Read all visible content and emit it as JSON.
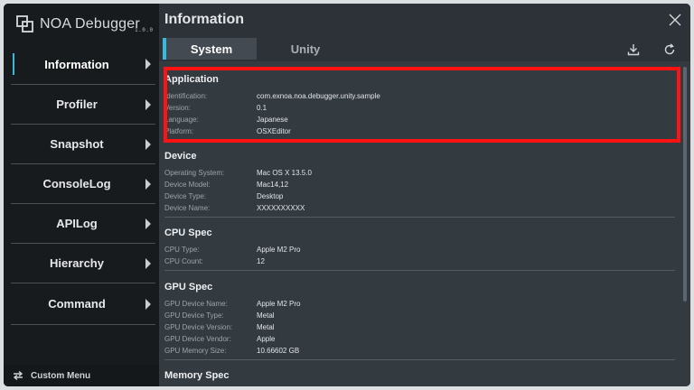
{
  "brand": {
    "name": "NOA Debugger",
    "version": "1.0.0"
  },
  "sidebar": {
    "items": [
      {
        "label": "Information",
        "active": true
      },
      {
        "label": "Profiler"
      },
      {
        "label": "Snapshot"
      },
      {
        "label": "ConsoleLog"
      },
      {
        "label": "APILog"
      },
      {
        "label": "Hierarchy"
      },
      {
        "label": "Command"
      }
    ],
    "custom_menu_label": "Custom Menu"
  },
  "header": {
    "title": "Information"
  },
  "tabs": [
    {
      "label": "System",
      "active": true
    },
    {
      "label": "Unity"
    }
  ],
  "sections": {
    "application": {
      "title": "Application",
      "rows": [
        {
          "key": "Identification:",
          "value": "com.exnoa.noa.debugger.unity.sample"
        },
        {
          "key": "Version:",
          "value": "0.1"
        },
        {
          "key": "Language:",
          "value": "Japanese"
        },
        {
          "key": "Platform:",
          "value": "OSXEditor"
        }
      ]
    },
    "device": {
      "title": "Device",
      "rows": [
        {
          "key": "Operating System:",
          "value": "Mac OS X 13.5.0"
        },
        {
          "key": "Device Model:",
          "value": "Mac14,12"
        },
        {
          "key": "Device Type:",
          "value": "Desktop"
        },
        {
          "key": "Device Name:",
          "value": "XXXXXXXXXX"
        }
      ]
    },
    "cpu": {
      "title": "CPU Spec",
      "rows": [
        {
          "key": "CPU Type:",
          "value": "Apple M2 Pro"
        },
        {
          "key": "CPU Count:",
          "value": "12"
        }
      ]
    },
    "gpu": {
      "title": "GPU Spec",
      "rows": [
        {
          "key": "GPU Device Name:",
          "value": "Apple M2 Pro"
        },
        {
          "key": "GPU Device Type:",
          "value": "Metal"
        },
        {
          "key": "GPU Device Version:",
          "value": "Metal"
        },
        {
          "key": "GPU Device Vendor:",
          "value": "Apple"
        },
        {
          "key": "GPU Memory Size:",
          "value": "10.66602 GB"
        }
      ]
    },
    "memory": {
      "title": "Memory Spec"
    }
  },
  "icons": {
    "logo": "noa-logo-icon",
    "chevron": "chevron-right-icon",
    "close": "close-icon",
    "download": "download-icon",
    "refresh": "refresh-icon",
    "custom_menu": "swap-arrows-icon"
  },
  "colors": {
    "accent": "#3cb8d8",
    "highlight": "#ff1212",
    "sidebar_bg": "#181b1e",
    "panel_bg": "#333a40"
  }
}
